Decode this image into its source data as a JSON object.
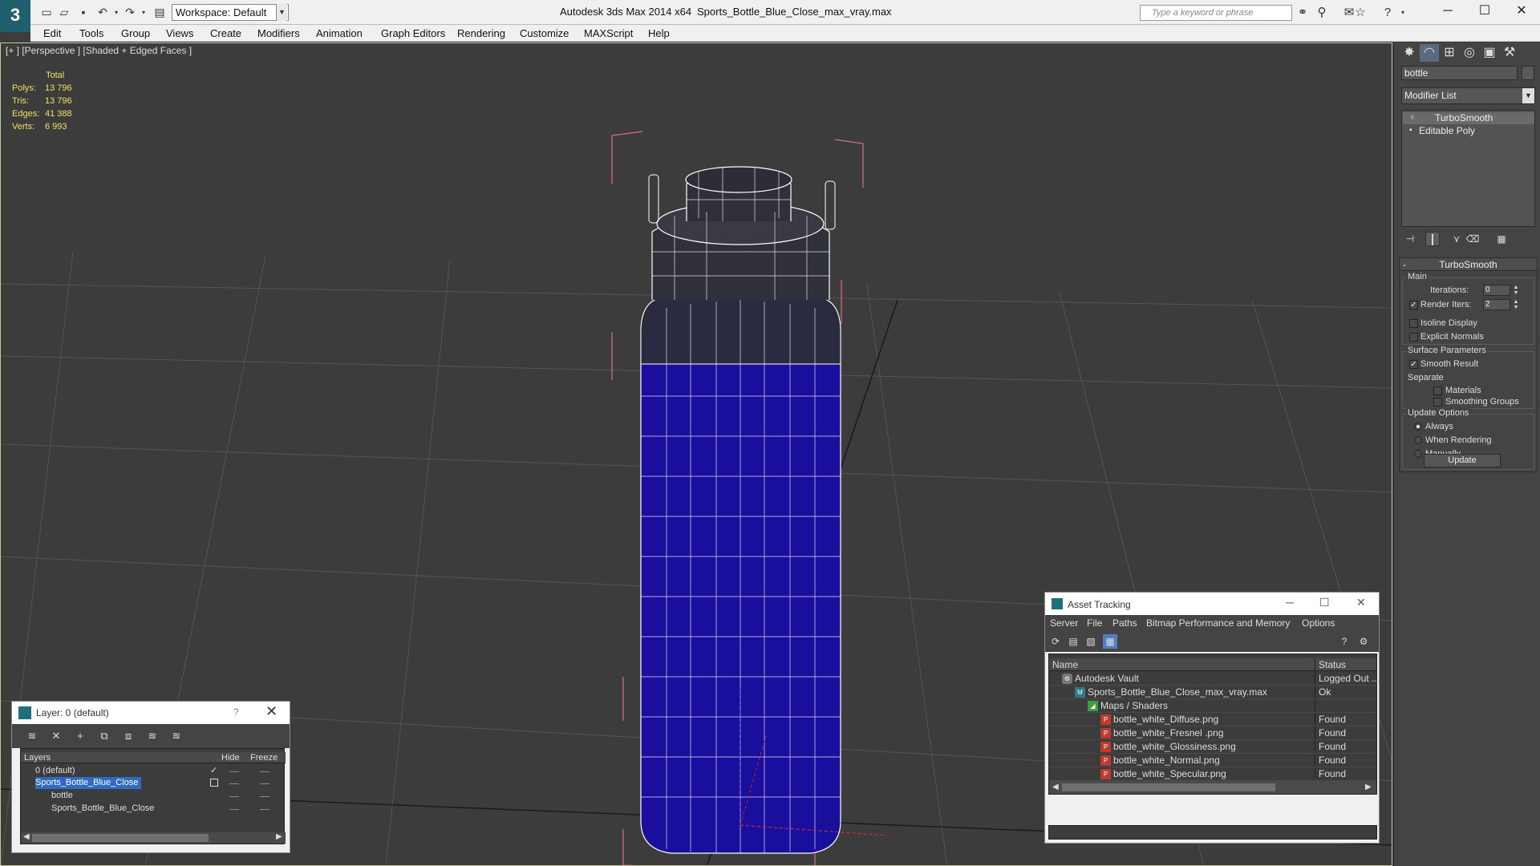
{
  "titlebar": {
    "app_title": "Autodesk 3ds Max  2014 x64",
    "doc_title": "Sports_Bottle_Blue_Close_max_vray.max",
    "workspace": "Workspace: Default",
    "search_placeholder": "Type a keyword or phrase",
    "logo": "3"
  },
  "menubar": [
    "Edit",
    "Tools",
    "Group",
    "Views",
    "Create",
    "Modifiers",
    "Animation",
    "Graph Editors",
    "Rendering",
    "Customize",
    "MAXScript",
    "Help"
  ],
  "viewport": {
    "label": "[+ ] [Perspective ] [Shaded + Edged Faces ]",
    "stats": {
      "header": "Total",
      "rows": [
        {
          "k": "Polys:",
          "v": "13 796"
        },
        {
          "k": "Tris:",
          "v": "13 796"
        },
        {
          "k": "Edges:",
          "v": "41 388"
        },
        {
          "k": "Verts:",
          "v": "6 993"
        }
      ]
    },
    "colors": {
      "bottle_body": "#1a0f9c",
      "wire": "#ffffff",
      "bbox": "#e06a8a",
      "grid": "#555555"
    }
  },
  "command_panel": {
    "object_name": "bottle",
    "modifier_list": "Modifier List",
    "stack": [
      "TurboSmooth",
      "Editable Poly"
    ],
    "turbosmooth": {
      "title": "TurboSmooth",
      "main": "Main",
      "iterations_label": "Iterations:",
      "iterations": "0",
      "render_iters_label": "Render Iters:",
      "render_iters": "2",
      "isoline": "Isoline Display",
      "explicit": "Explicit Normals",
      "surface": "Surface Parameters",
      "smooth_result": "Smooth Result",
      "separate": "Separate",
      "materials": "Materials",
      "smoothing_groups": "Smoothing Groups",
      "update_options": "Update Options",
      "always": "Always",
      "when_rendering": "When Rendering",
      "manually": "Manually",
      "update": "Update"
    }
  },
  "layer_window": {
    "title": "Layer: 0 (default)",
    "help": "?",
    "columns": {
      "layers": "Layers",
      "hide": "Hide",
      "freeze": "Freeze"
    },
    "rows": [
      {
        "name": "0 (default)",
        "indent": 0
      },
      {
        "name": "Sports_Bottle_Blue_Close",
        "indent": 0
      },
      {
        "name": "bottle",
        "indent": 1
      },
      {
        "name": "Sports_Bottle_Blue_Close",
        "indent": 1
      }
    ]
  },
  "asset_window": {
    "title": "Asset Tracking",
    "menu": [
      "Server",
      "File",
      "Paths",
      "Bitmap Performance and Memory",
      "Options"
    ],
    "columns": {
      "name": "Name",
      "status": "Status"
    },
    "rows": [
      {
        "name": "Autodesk Vault",
        "status": "Logged Out ...",
        "indent": 0,
        "icon": "vault"
      },
      {
        "name": "Sports_Bottle_Blue_Close_max_vray.max",
        "status": "Ok",
        "indent": 1,
        "icon": "max"
      },
      {
        "name": "Maps / Shaders",
        "status": "",
        "indent": 2,
        "icon": "maps"
      },
      {
        "name": "bottle_white_Diffuse.png",
        "status": "Found",
        "indent": 3,
        "icon": "png"
      },
      {
        "name": "bottle_white_Fresnel .png",
        "status": "Found",
        "indent": 3,
        "icon": "png"
      },
      {
        "name": "bottle_white_Glossiness.png",
        "status": "Found",
        "indent": 3,
        "icon": "png"
      },
      {
        "name": "bottle_white_Normal.png",
        "status": "Found",
        "indent": 3,
        "icon": "png"
      },
      {
        "name": "bottle_white_Specular.png",
        "status": "Found",
        "indent": 3,
        "icon": "png"
      }
    ]
  }
}
